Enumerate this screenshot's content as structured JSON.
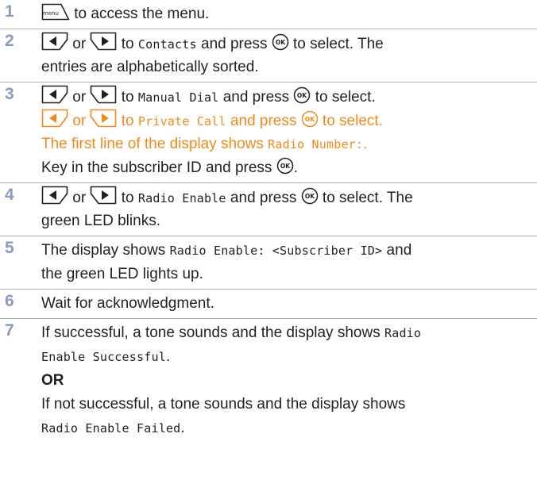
{
  "steps": [
    {
      "num": "1",
      "text_after_menu": " to access the menu."
    },
    {
      "num": "2",
      "or": "or",
      "to": " to ",
      "target": "Contacts",
      "press": " and press ",
      "select": " to select. The",
      "line2": "entries are alphabetically sorted."
    },
    {
      "num": "3",
      "or": "or",
      "to": " to ",
      "target": "Manual Dial",
      "press": " and press ",
      "select": " to select.",
      "l2_or": "or",
      "l2_to": " to ",
      "l2_target": "Private Call",
      "l2_press": " and press ",
      "l2_select": " to select.",
      "l3_text": "The first line of the display shows ",
      "l3_mono": "Radio Number:",
      "l3_end": ".",
      "l4_text": "Key in the subscriber ID and press ",
      "l4_end": "."
    },
    {
      "num": "4",
      "or": "or",
      "to": " to ",
      "target": "Radio Enable",
      "press": " and press ",
      "select": " to select. The",
      "line2": "green LED blinks."
    },
    {
      "num": "5",
      "text": "The display shows ",
      "mono": "Radio Enable: <Subscriber ID>",
      "text_end": " and",
      "line2": "the green LED lights up."
    },
    {
      "num": "6",
      "text": "Wait for acknowledgment."
    },
    {
      "num": "7",
      "l1_text": "If successful, a tone sounds and the display shows ",
      "l1_mono": "Radio",
      "l2_mono": "Enable Successful",
      "l2_end": ".",
      "or_label": "OR",
      "l4_text": "If not successful, a tone sounds and the display shows",
      "l5_mono": "Radio Enable Failed",
      "l5_end": "."
    }
  ],
  "icons": {
    "menu_key_label": "menu",
    "ok_key_label": "OK"
  },
  "colors": {
    "step_number": "#8b9bbf",
    "highlight": "#f28a1b",
    "divider": "#a5b1c9",
    "text": "#231f20"
  }
}
